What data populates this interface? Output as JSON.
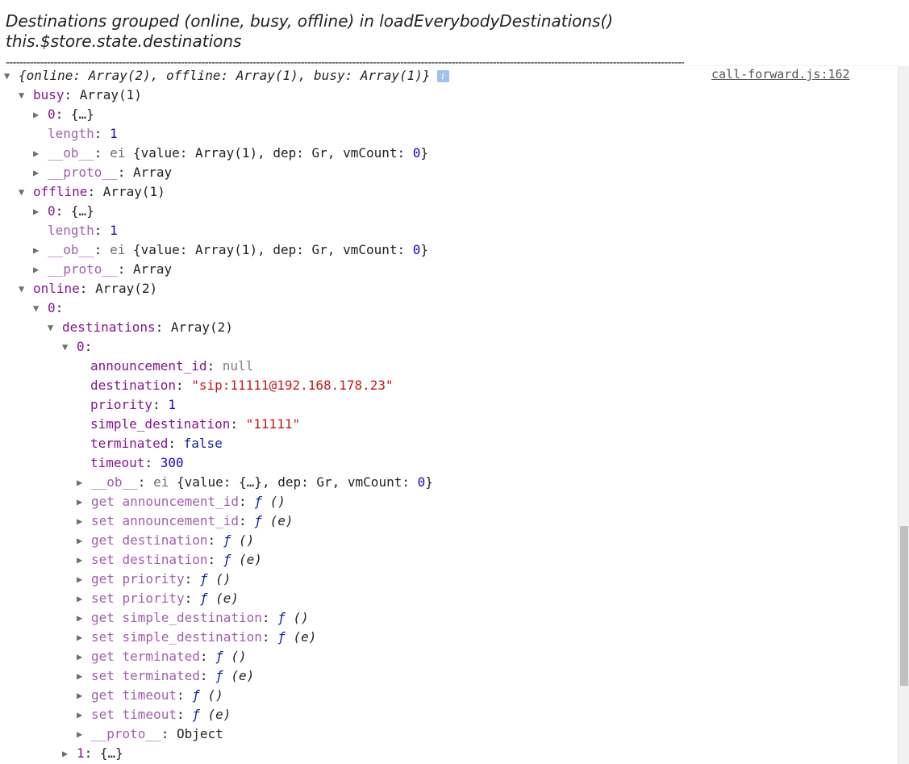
{
  "header": {
    "dashes_top": "------------------------------------------------------------------------------------------------------------------------------------------------------------------------------------------------------------------",
    "message_line1": "Destinations grouped (online, busy, offline) in loadEverybodyDestinations()",
    "message_line2": "this.$store.state.destinations",
    "dashes_bottom": "------------------------------------------------------------------------------------------------------------------------------------------------------------------------------------------------------------------"
  },
  "source_link": "call-forward.js:162",
  "root": {
    "summary": "{online: Array(2), offline: Array(1), busy: Array(1)}",
    "info_icon": "i"
  },
  "busy": {
    "key": "busy",
    "value": "Array(1)",
    "item0_key": "0",
    "item0_value": "{…}",
    "length_key": "length",
    "length_value": "1",
    "ob_key": "__ob__",
    "ob_class": "ei",
    "ob_open": "{value: ",
    "ob_value": "Array(1)",
    "ob_dep": ", dep: ",
    "ob_dep_val": "Gr",
    "ob_vm": ", vmCount: ",
    "ob_vm_val": "0",
    "ob_close": "}",
    "proto_key": "__proto__",
    "proto_value": "Array"
  },
  "offline": {
    "key": "offline",
    "value": "Array(1)",
    "item0_key": "0",
    "item0_value": "{…}",
    "length_key": "length",
    "length_value": "1",
    "ob_key": "__ob__",
    "ob_class": "ei",
    "ob_open": "{value: ",
    "ob_value": "Array(1)",
    "ob_dep": ", dep: ",
    "ob_dep_val": "Gr",
    "ob_vm": ", vmCount: ",
    "ob_vm_val": "0",
    "ob_close": "}",
    "proto_key": "__proto__",
    "proto_value": "Array"
  },
  "online": {
    "key": "online",
    "value": "Array(2)",
    "item0_key": "0",
    "destinations_key": "destinations",
    "destinations_value": "Array(2)",
    "dest0_key": "0",
    "fields": {
      "announcement_id_key": "announcement_id",
      "announcement_id_value": "null",
      "destination_key": "destination",
      "destination_value": "\"sip:11111@192.168.178.23\"",
      "priority_key": "priority",
      "priority_value": "1",
      "simple_destination_key": "simple_destination",
      "simple_destination_value": "\"11111\"",
      "terminated_key": "terminated",
      "terminated_value": "false",
      "timeout_key": "timeout",
      "timeout_value": "300"
    },
    "ob": {
      "key": "__ob__",
      "class": "ei",
      "open": "{value: ",
      "value": "{…}",
      "dep": ", dep: ",
      "dep_val": "Gr",
      "vm": ", vmCount: ",
      "vm_val": "0",
      "close": "}"
    },
    "accessors": [
      {
        "key": "get announcement_id",
        "sym": "ƒ",
        "args": " ()"
      },
      {
        "key": "set announcement_id",
        "sym": "ƒ",
        "args": " (e)"
      },
      {
        "key": "get destination",
        "sym": "ƒ",
        "args": " ()"
      },
      {
        "key": "set destination",
        "sym": "ƒ",
        "args": " (e)"
      },
      {
        "key": "get priority",
        "sym": "ƒ",
        "args": " ()"
      },
      {
        "key": "set priority",
        "sym": "ƒ",
        "args": " (e)"
      },
      {
        "key": "get simple_destination",
        "sym": "ƒ",
        "args": " ()"
      },
      {
        "key": "set simple_destination",
        "sym": "ƒ",
        "args": " (e)"
      },
      {
        "key": "get terminated",
        "sym": "ƒ",
        "args": " ()"
      },
      {
        "key": "set terminated",
        "sym": "ƒ",
        "args": " (e)"
      },
      {
        "key": "get timeout",
        "sym": "ƒ",
        "args": " ()"
      },
      {
        "key": "set timeout",
        "sym": "ƒ",
        "args": " (e)"
      }
    ],
    "proto_key": "__proto__",
    "proto_value": "Object",
    "dest1_key": "1",
    "dest1_value": "{…}"
  },
  "colors": {
    "key": "#881391",
    "number": "#1c00cf",
    "string": "#c41a16",
    "null": "#808080",
    "function_symbol": "#0d22aa"
  },
  "icons": {
    "expanded": "triangle-down-icon",
    "collapsed": "triangle-right-icon",
    "info": "info-icon"
  }
}
